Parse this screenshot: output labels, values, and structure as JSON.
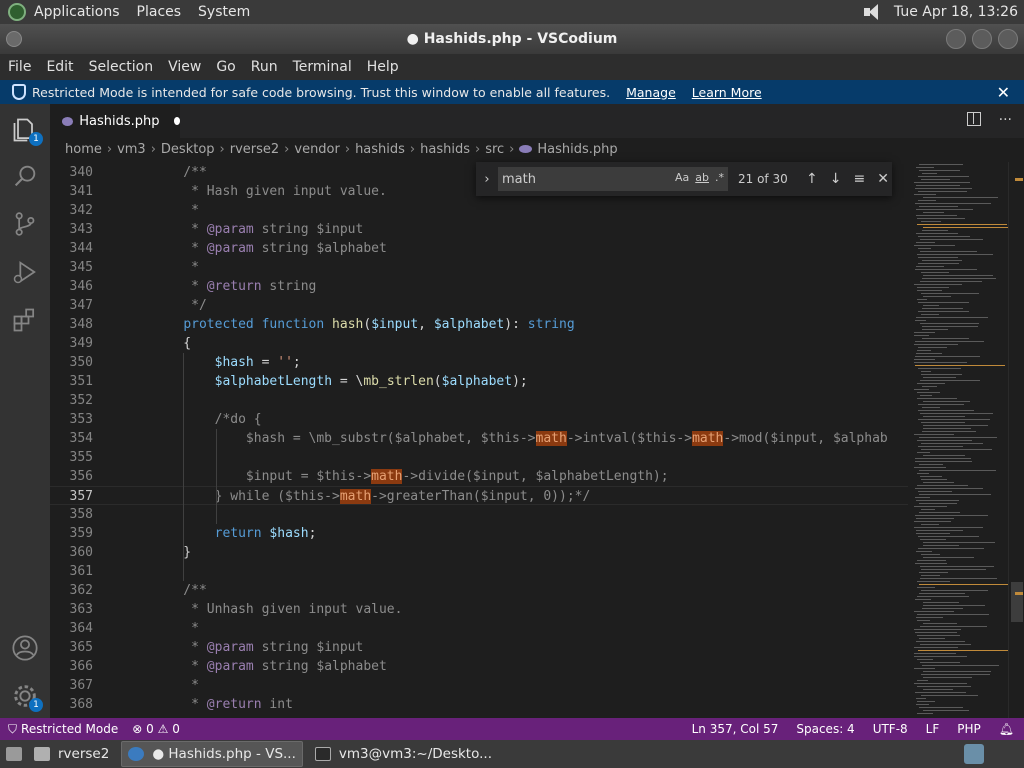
{
  "system_panel": {
    "menus": [
      "Applications",
      "Places",
      "System"
    ],
    "clock": "Tue Apr 18, 13:26"
  },
  "window": {
    "title": "● Hashids.php - VSCodium"
  },
  "menubar": [
    "File",
    "Edit",
    "Selection",
    "View",
    "Go",
    "Run",
    "Terminal",
    "Help"
  ],
  "banner": {
    "text": "Restricted Mode is intended for safe code browsing. Trust this window to enable all features.",
    "manage": "Manage",
    "learn_more": "Learn More",
    "close": "✕"
  },
  "activity_badges": {
    "explorer": "1",
    "settings": "1"
  },
  "tab": {
    "label": "Hashids.php"
  },
  "breadcrumb": [
    "home",
    "vm3",
    "Desktop",
    "rverse2",
    "vendor",
    "hashids",
    "hashids",
    "src",
    "Hashids.php"
  ],
  "find": {
    "query": "math",
    "match_case": "Aa",
    "whole_word": "ab",
    "regex": ".*",
    "count": "21 of 30"
  },
  "editor": {
    "current_line": "357",
    "lines": [
      {
        "n": "340",
        "t": "    /**"
      },
      {
        "n": "341",
        "t": "     * Hash given input value."
      },
      {
        "n": "342",
        "t": "     *"
      },
      {
        "n": "343",
        "t": "     * @param string $input"
      },
      {
        "n": "344",
        "t": "     * @param string $alphabet"
      },
      {
        "n": "345",
        "t": "     *"
      },
      {
        "n": "346",
        "t": "     * @return string"
      },
      {
        "n": "347",
        "t": "     */"
      },
      {
        "n": "348",
        "t": "    protected function hash($input, $alphabet): string"
      },
      {
        "n": "349",
        "t": "    {"
      },
      {
        "n": "350",
        "t": "        $hash = '';"
      },
      {
        "n": "351",
        "t": "        $alphabetLength = \\mb_strlen($alphabet);"
      },
      {
        "n": "352",
        "t": ""
      },
      {
        "n": "353",
        "t": "        /*do {"
      },
      {
        "n": "354",
        "t": "            $hash = \\mb_substr($alphabet, $this->math->intval($this->math->mod($input, $alphab"
      },
      {
        "n": "355",
        "t": ""
      },
      {
        "n": "356",
        "t": "            $input = $this->math->divide($input, $alphabetLength);"
      },
      {
        "n": "357",
        "t": "        } while ($this->math->greaterThan($input, 0));*/"
      },
      {
        "n": "358",
        "t": ""
      },
      {
        "n": "359",
        "t": "        return $hash;"
      },
      {
        "n": "360",
        "t": "    }"
      },
      {
        "n": "361",
        "t": ""
      },
      {
        "n": "362",
        "t": "    /**"
      },
      {
        "n": "363",
        "t": "     * Unhash given input value."
      },
      {
        "n": "364",
        "t": "     *"
      },
      {
        "n": "365",
        "t": "     * @param string $input"
      },
      {
        "n": "366",
        "t": "     * @param string $alphabet"
      },
      {
        "n": "367",
        "t": "     *"
      },
      {
        "n": "368",
        "t": "     * @return int"
      }
    ]
  },
  "statusbar": {
    "restricted": "Restricted Mode",
    "errors": "0",
    "warnings": "0",
    "position": "Ln 357, Col 57",
    "spaces": "Spaces: 4",
    "encoding": "UTF-8",
    "eol": "LF",
    "language": "PHP"
  },
  "taskbar": {
    "items": [
      "rverse2",
      "● Hashids.php - VS...",
      "vm3@vm3:~/Deskto..."
    ]
  },
  "colors": {
    "statusbar": "#68217a",
    "banner": "#063b6a",
    "match_highlight": "#8b3a10"
  }
}
